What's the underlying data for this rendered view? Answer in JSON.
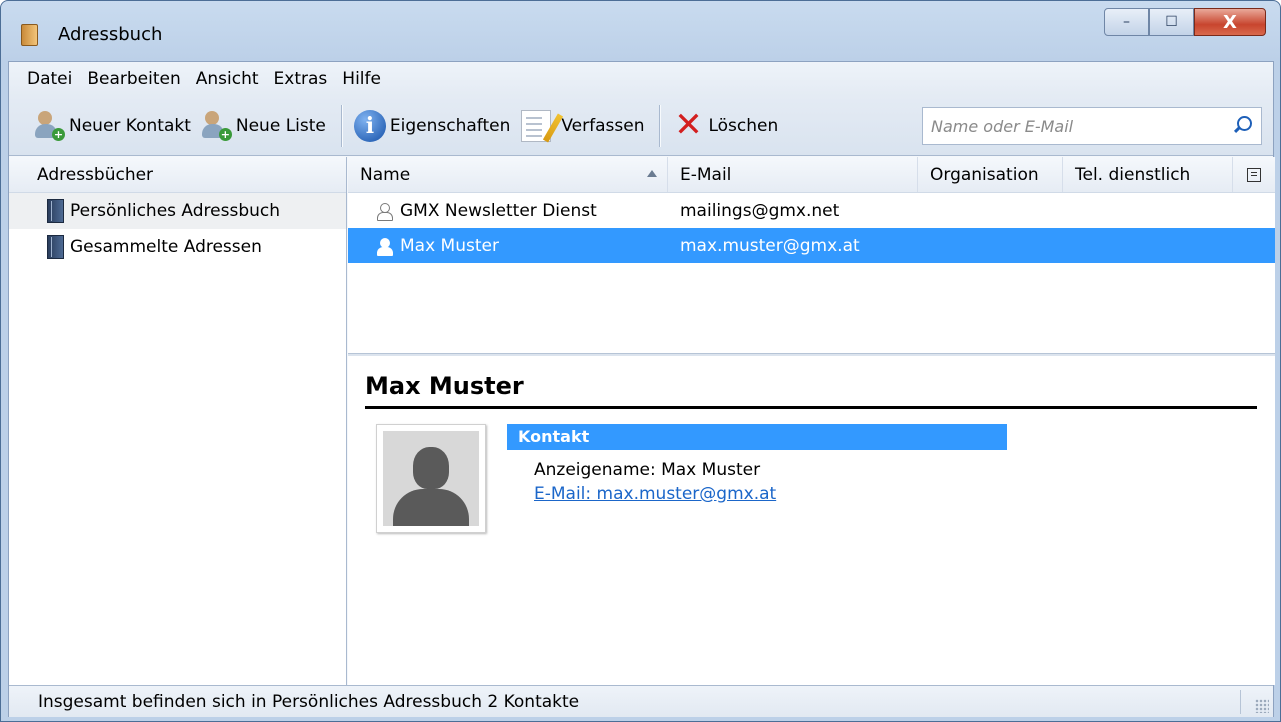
{
  "window": {
    "title": "Adressbuch",
    "min": "–",
    "max": "☐",
    "close": "X"
  },
  "menu": [
    {
      "label": "Datei"
    },
    {
      "label": "Bearbeiten"
    },
    {
      "label": "Ansicht"
    },
    {
      "label": "Extras"
    },
    {
      "label": "Hilfe"
    }
  ],
  "toolbar": {
    "new_contact": "Neuer Kontakt",
    "new_list": "Neue Liste",
    "properties": "Eigenschaften",
    "compose": "Verfassen",
    "delete": "Löschen",
    "search_placeholder": "Name oder E-Mail"
  },
  "sidebar": {
    "header": "Adressbücher",
    "items": [
      {
        "label": "Persönliches Adressbuch",
        "selected": true
      },
      {
        "label": "Gesammelte Adressen",
        "selected": false
      }
    ]
  },
  "list": {
    "columns": [
      "Name",
      "E-Mail",
      "Organisation",
      "Tel. dienstlich"
    ],
    "sort_column": "Name",
    "rows": [
      {
        "name": "GMX Newsletter Dienst",
        "email": "mailings@gmx.net",
        "selected": false
      },
      {
        "name": "Max Muster",
        "email": "max.muster@gmx.at",
        "selected": true
      }
    ]
  },
  "detail": {
    "name": "Max Muster",
    "section": "Kontakt",
    "display_name_line": "Anzeigename: Max Muster",
    "email_line": "E-Mail: max.muster@gmx.at"
  },
  "status": {
    "text": "Insgesamt befinden sich in Persönliches Adressbuch 2 Kontakte"
  },
  "colors": {
    "selection": "#3399ff",
    "link": "#1b66c9",
    "delete": "#d31f1f"
  }
}
